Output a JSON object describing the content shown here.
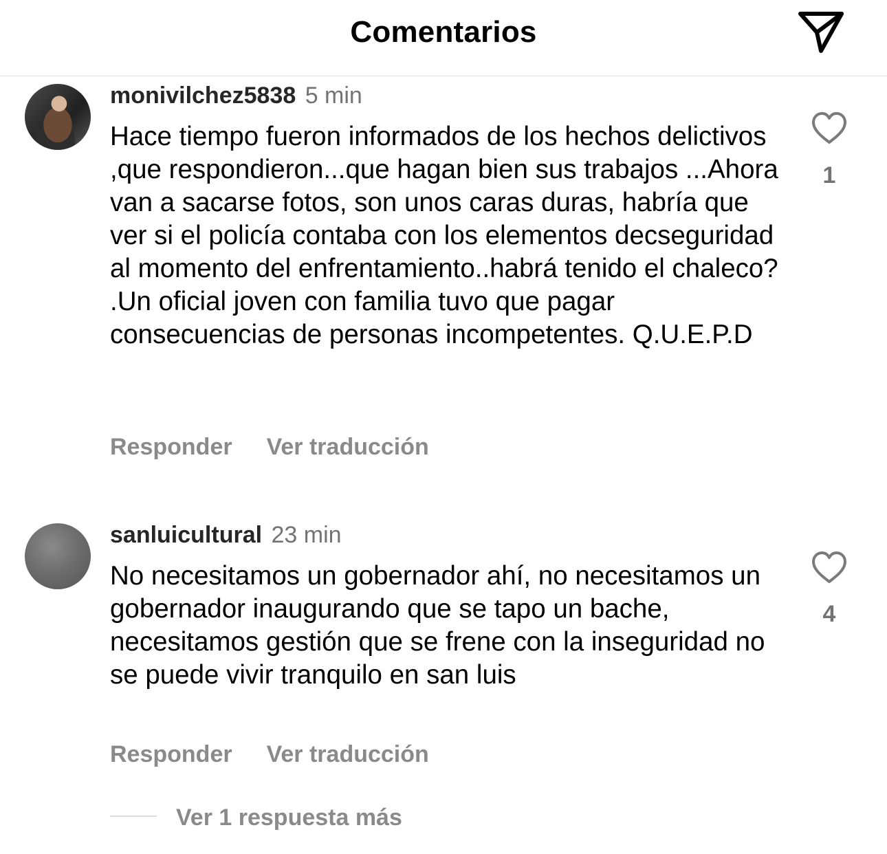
{
  "header": {
    "title": "Comentarios",
    "share_icon": "paper-plane-icon"
  },
  "comments": [
    {
      "username": "monivilchez5838",
      "time": "5 min",
      "text": "Hace tiempo fueron informados de los hechos delictivos ,que respondieron...que hagan bien sus trabajos ...Ahora van a sacarse fotos, son unos caras duras, habría que ver si el policía contaba con los elementos decseguridad al momento del enfrentamiento..habrá tenido el chaleco? .Un oficial joven con familia tuvo que pagar consecuencias de personas incompetentes. Q.U.E.P.D",
      "likes": "1",
      "reply_label": "Responder",
      "translate_label": "Ver traducción"
    },
    {
      "username": "sanluicultural",
      "time": "23 min",
      "text": "No necesitamos un gobernador ahí, no necesitamos un gobernador inaugurando que se tapo un bache, necesitamos gestión que se frene con la inseguridad no se puede vivir tranquilo en san luis",
      "likes": "4",
      "reply_label": "Responder",
      "translate_label": "Ver traducción"
    }
  ],
  "more_replies_label": "Ver 1 respuesta más"
}
